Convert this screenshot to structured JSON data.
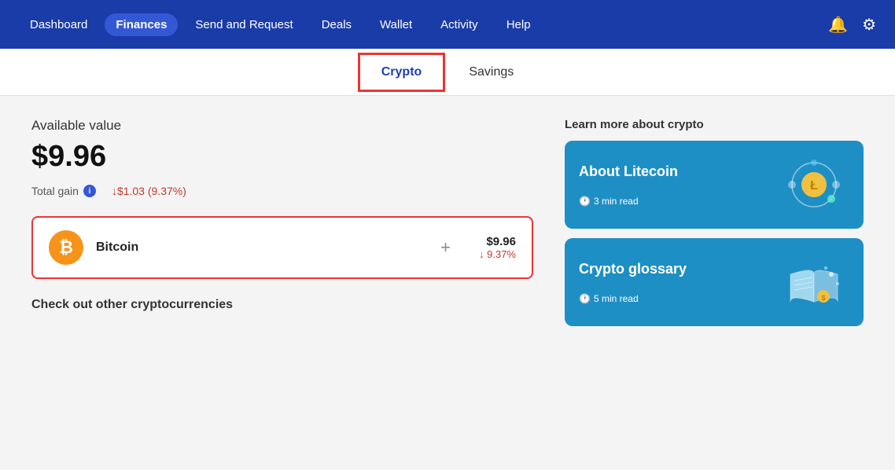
{
  "nav": {
    "items": [
      {
        "label": "Dashboard",
        "active": false
      },
      {
        "label": "Finances",
        "active": true
      },
      {
        "label": "Send and Request",
        "active": false
      },
      {
        "label": "Deals",
        "active": false
      },
      {
        "label": "Wallet",
        "active": false
      },
      {
        "label": "Activity",
        "active": false
      },
      {
        "label": "Help",
        "active": false
      }
    ],
    "bell_label": "🔔",
    "gear_label": "⚙"
  },
  "subnav": {
    "items": [
      {
        "label": "Crypto",
        "active": true
      },
      {
        "label": "Savings",
        "active": false
      }
    ]
  },
  "main": {
    "available_label": "Available value",
    "available_value": "$9.96",
    "total_gain_label": "Total gain",
    "total_gain_value": "↓$1.03 (9.37%)",
    "crypto_card": {
      "name": "Bitcoin",
      "plus": "+",
      "amount": "$9.96",
      "change": "↓ 9.37%"
    },
    "check_other": "Check out other cryptocurrencies"
  },
  "sidebar": {
    "learn_title": "Learn more about crypto",
    "cards": [
      {
        "title": "About Litecoin",
        "time": "3 min read"
      },
      {
        "title": "Crypto glossary",
        "time": "5 min read"
      }
    ]
  }
}
